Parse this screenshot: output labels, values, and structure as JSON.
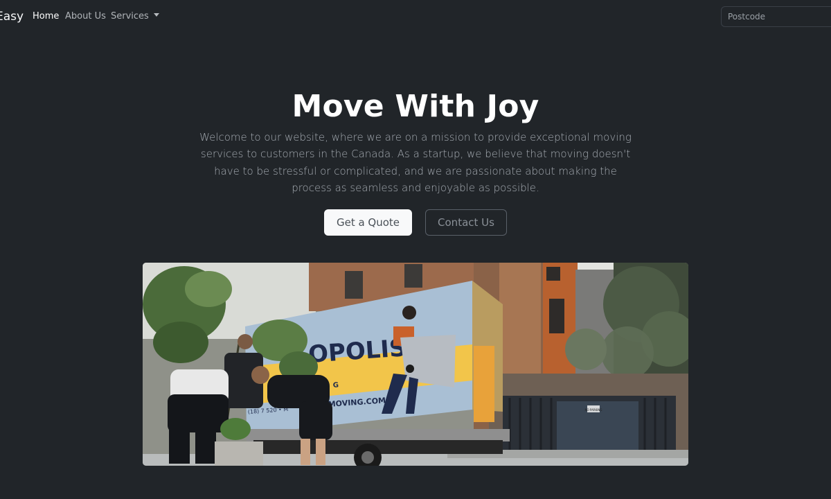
{
  "navbar": {
    "brand": "Easy",
    "links": [
      {
        "label": "Home",
        "active": true
      },
      {
        "label": "About Us",
        "active": false
      },
      {
        "label": "Services",
        "active": false,
        "dropdown": true
      }
    ],
    "search": {
      "placeholder": "Postcode",
      "value": ""
    }
  },
  "hero": {
    "title": "Move With Joy",
    "lead": "Welcome to our website, where we are on a mission to provide exceptional moving services to customers in the Canada. As a startup, we believe that moving doesn't have to be stressful or complicated, and we are passionate about making the process as seamless and enjoyable as possible.",
    "primary_button": "Get a Quote",
    "secondary_button": "Contact Us",
    "image": {
      "truck_text_main": "OPOLIS",
      "truck_text_sub": "G",
      "truck_text_url": "MOVING.COM",
      "truck_phone": "(18) 7 520 • M",
      "sign_text": "NO PARKING"
    }
  },
  "colors": {
    "background": "#212529",
    "primary_text": "#ffffff",
    "muted_text": "#a7adb4",
    "truck_blue": "#a9bfd4",
    "truck_yellow": "#f2c54a",
    "truck_navy": "#1f2b4d"
  }
}
